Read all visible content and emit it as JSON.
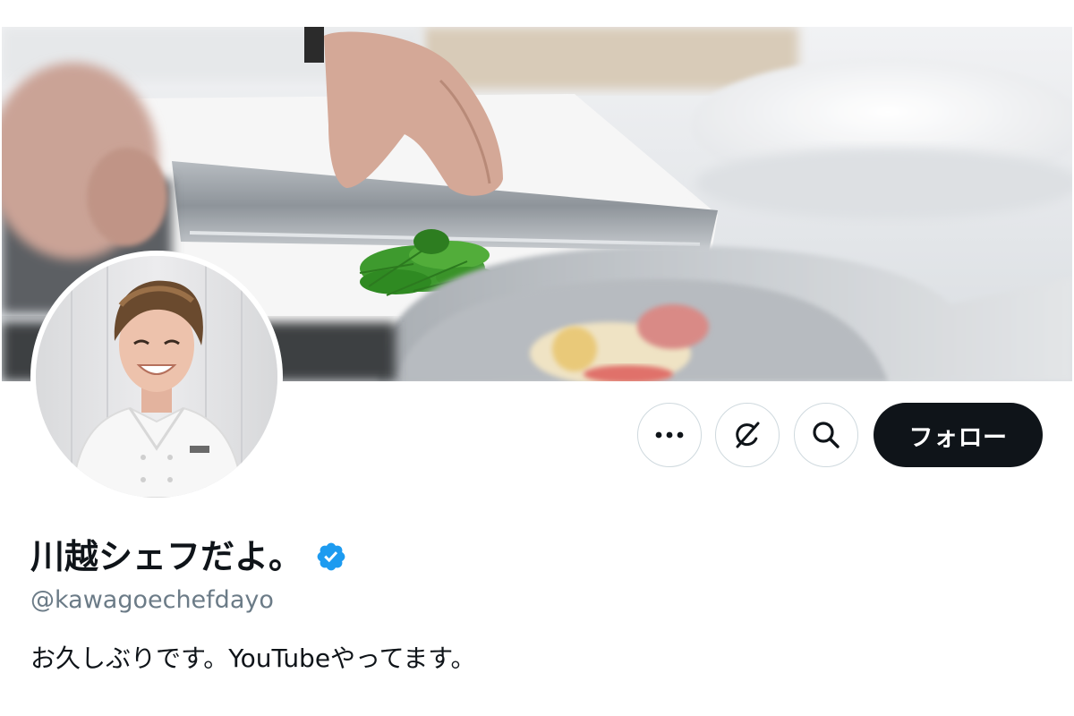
{
  "profile": {
    "display_name": "川越シェフだよ。",
    "handle": "@kawagoechefdayo",
    "bio": "お久しぶりです。YouTubeやってます。",
    "verified": true,
    "verified_color": "#1d9bf0"
  },
  "banner": {
    "image": "kitchen-chopping-herbs-photo"
  },
  "avatar": {
    "image": "chef-portrait-photo"
  },
  "actions": {
    "more_icon": "more-horizontal-icon",
    "grok_icon": "grok-icon",
    "search_icon": "search-icon",
    "follow_label": "フォロー",
    "follow_bg": "#0f1419"
  }
}
